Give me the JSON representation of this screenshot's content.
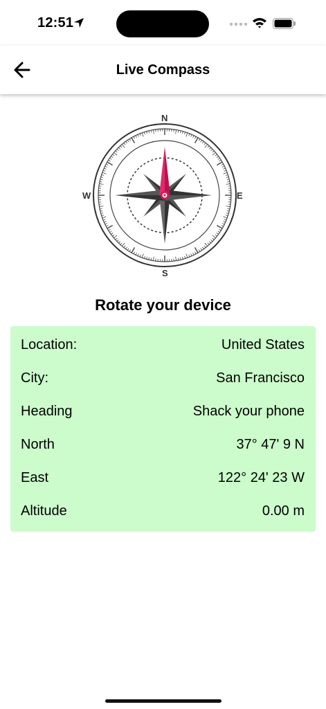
{
  "status_bar": {
    "time": "12:51"
  },
  "nav": {
    "title": "Live Compass",
    "back_icon": "arrow-left-icon"
  },
  "compass": {
    "north": "N",
    "east": "E",
    "south": "S",
    "west": "W",
    "heading_deg": 0,
    "needle_color": "#d41c5c"
  },
  "prompt": "Rotate your device",
  "info": {
    "background": "#ccfccc",
    "rows": [
      {
        "label": "Location:",
        "value": "United States"
      },
      {
        "label": "City:",
        "value": "San Francisco"
      },
      {
        "label": "Heading",
        "value": "Shack your phone"
      },
      {
        "label": "North",
        "value": "37° 47' 9 N"
      },
      {
        "label": "East",
        "value": "122° 24' 23 W"
      },
      {
        "label": "Altitude",
        "value": "0.00 m"
      }
    ]
  }
}
